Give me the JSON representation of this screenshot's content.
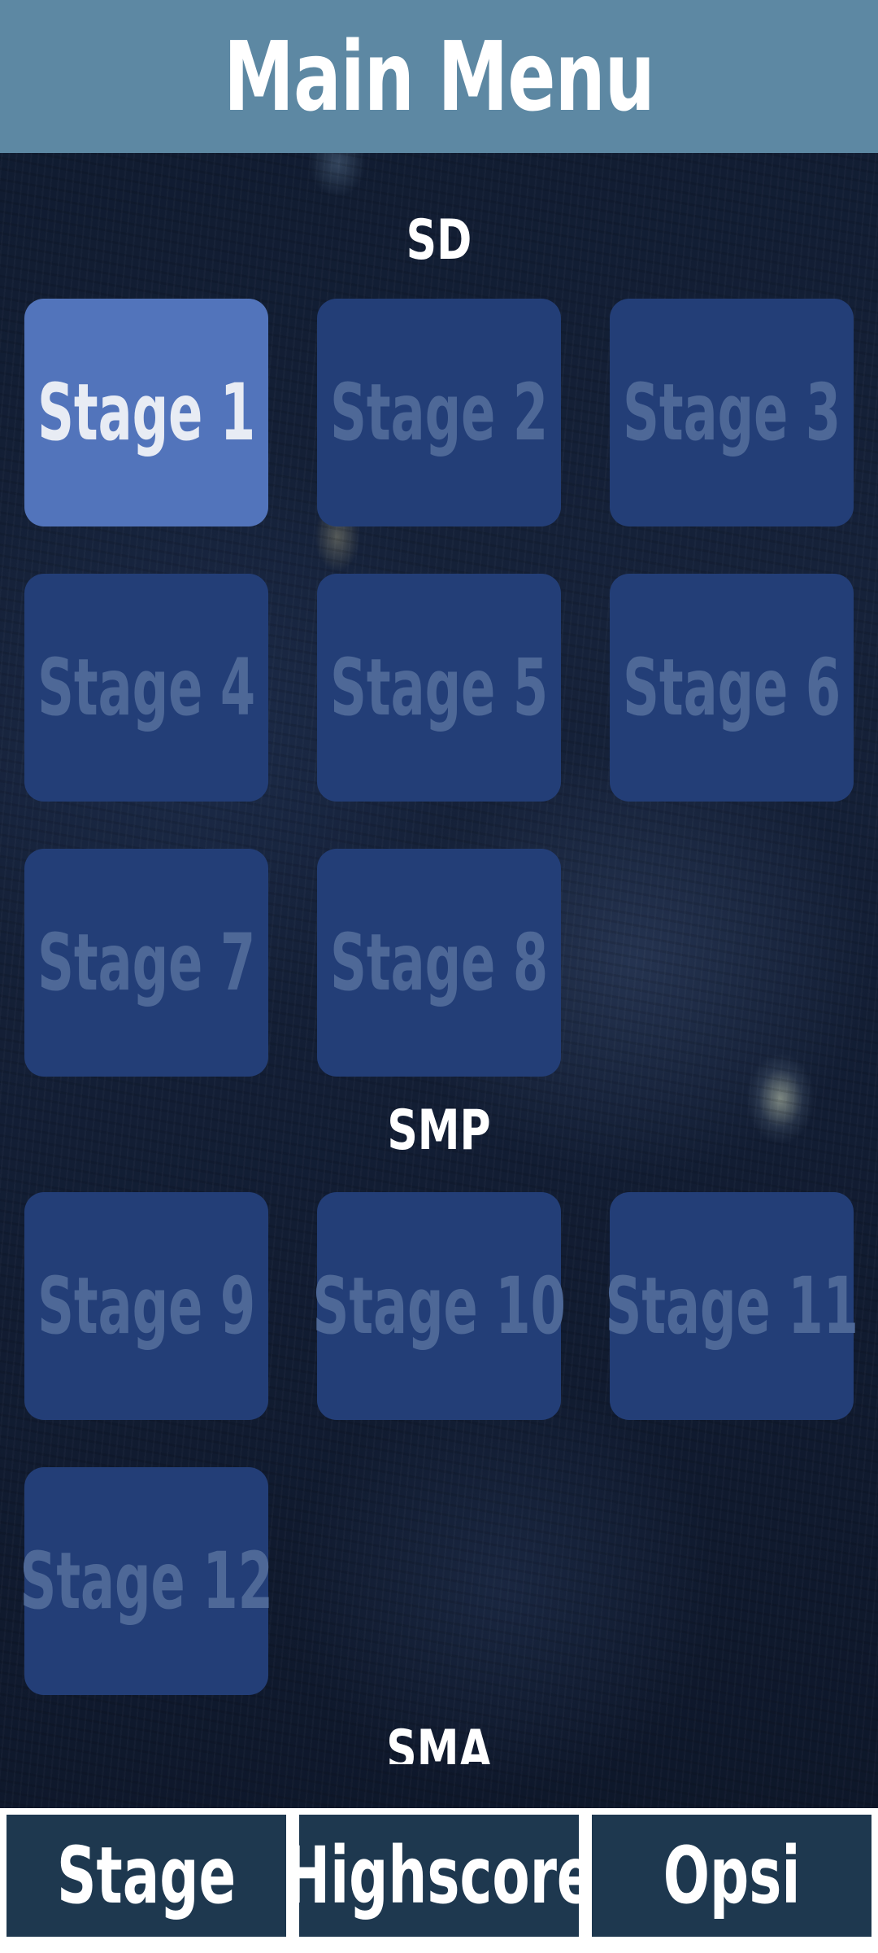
{
  "header": {
    "title": "Main Menu"
  },
  "sections": {
    "sd": {
      "label": "SD",
      "stages": [
        "Stage 1",
        "Stage 2",
        "Stage 3",
        "Stage 4",
        "Stage 5",
        "Stage 6",
        "Stage 7",
        "Stage 8"
      ]
    },
    "smp": {
      "label": "SMP",
      "stages": [
        "Stage 9",
        "Stage 10",
        "Stage 11",
        "Stage 12"
      ]
    },
    "sma": {
      "label": "SMA"
    }
  },
  "active_stage": "Stage 1",
  "tabs": [
    "Stage",
    "Highscore",
    "Opsi"
  ],
  "colors": {
    "header_bg": "#5d88a3",
    "stage_active_bg": "#5274bb",
    "stage_locked_bg": "#233e77",
    "stage_locked_text": "#4e6897",
    "tab_bg": "#1e384f"
  }
}
